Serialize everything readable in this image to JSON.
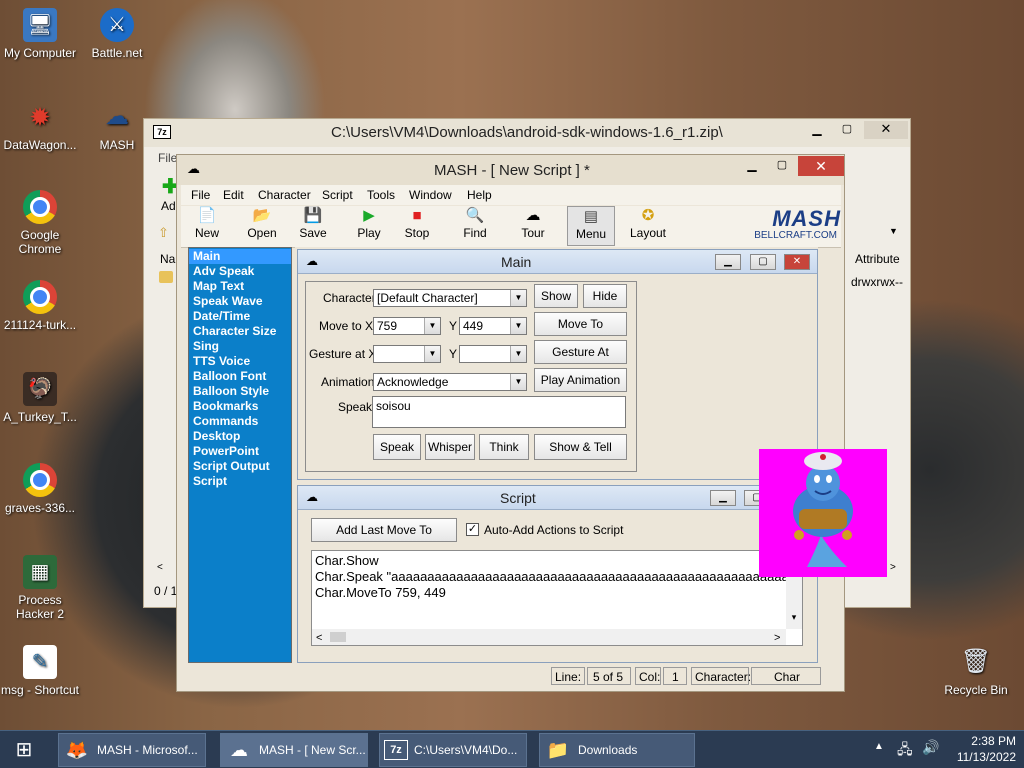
{
  "desktop": {
    "icons": [
      {
        "label": "My Computer",
        "glyph": "🖥"
      },
      {
        "label": "Battle.net",
        "glyph": "⚔"
      },
      {
        "label": "DataWagon...",
        "glyph": "✹"
      },
      {
        "label": "MASH",
        "glyph": "☁"
      },
      {
        "label": "Google Chrome",
        "glyph": ""
      },
      {
        "label": "211124-turk...",
        "glyph": ""
      },
      {
        "label": "A_Turkey_T...",
        "glyph": "🦃"
      },
      {
        "label": "graves-336...",
        "glyph": ""
      },
      {
        "label": "Process Hacker 2",
        "glyph": "▦"
      },
      {
        "label": "msg - Shortcut",
        "glyph": "✎"
      },
      {
        "label": "Recycle Bin",
        "glyph": "🗑"
      }
    ]
  },
  "zip_window": {
    "title": "C:\\Users\\VM4\\Downloads\\android-sdk-windows-1.6_r1.zip\\",
    "menu_first": "File",
    "add_label": "Ad",
    "col_name": "Nar",
    "col_attributes": "Attribute",
    "attr_value": "drwxrwx--",
    "status": "0 / 1"
  },
  "mash": {
    "title": "MASH - [ New Script ] *",
    "menu": [
      "File",
      "Edit",
      "Character",
      "Script",
      "Tools",
      "Window",
      "Help"
    ],
    "toolbar": [
      {
        "label": "New",
        "icon": "new-icon",
        "glyph": "📄"
      },
      {
        "label": "Open",
        "icon": "open-folder-icon",
        "glyph": "📂"
      },
      {
        "label": "Save",
        "icon": "save-icon",
        "glyph": "💾"
      },
      {
        "label": "Play",
        "icon": "play-icon",
        "glyph": "▶"
      },
      {
        "label": "Stop",
        "icon": "stop-icon",
        "glyph": "■"
      },
      {
        "label": "Find",
        "icon": "find-icon",
        "glyph": "🔍"
      },
      {
        "label": "Tour",
        "icon": "tour-icon",
        "glyph": "☁"
      },
      {
        "label": "Menu",
        "icon": "menu-icon",
        "glyph": "▤"
      },
      {
        "label": "Layout",
        "icon": "layout-icon",
        "glyph": "✪"
      }
    ],
    "logo_text": "MASH",
    "logo_sub": "BELLCRAFT.COM",
    "sidebar": [
      "Main",
      "Adv Speak",
      "Map Text",
      "Speak Wave",
      "Date/Time",
      "Character Size",
      "Sing",
      "TTS Voice",
      "Balloon Font",
      "Balloon Style",
      "Bookmarks",
      "Commands",
      "Desktop",
      "PowerPoint",
      "Script Output",
      "Script"
    ],
    "main_panel": {
      "title": "Main",
      "character_label": "Character",
      "character_value": "[Default Character]",
      "show_btn": "Show",
      "hide_btn": "Hide",
      "move_to_label": "Move to X",
      "move_x": "759",
      "move_y_label": "Y",
      "move_y": "449",
      "move_to_btn": "Move To",
      "gesture_label": "Gesture at X",
      "gesture_x": "",
      "gesture_y_label": "Y",
      "gesture_y": "",
      "gesture_btn": "Gesture At",
      "animation_label": "Animation",
      "animation_value": "Acknowledge",
      "play_anim_btn": "Play Animation",
      "speak_label": "Speak",
      "speak_text": "soisou",
      "speak_btn": "Speak",
      "whisper_btn": "Whisper",
      "think_btn": "Think",
      "show_tell_btn": "Show & Tell"
    },
    "script_panel": {
      "title": "Script",
      "add_last_btn": "Add Last Move To",
      "auto_add_label": "Auto-Add Actions to Script",
      "auto_add_checked": true,
      "lines": [
        "Char.Show",
        "Char.Speak \"aaaaaaaaaaaaaaaaaaaaaaaaaaaaaaaaaaaaaaaaaaaaaaaaaaaaaaaaaaaaaaaaa",
        "Char.MoveTo 759, 449"
      ]
    },
    "status": {
      "line_label": "Line:",
      "line_value": "5 of 5",
      "col_label": "Col:",
      "col_value": "1",
      "character_label": "Character:",
      "character_value": "Char"
    }
  },
  "taskbar": {
    "tasks": [
      {
        "label": "MASH - Microsof...",
        "icon": "firefox-icon",
        "glyph": "🦊"
      },
      {
        "label": "MASH - [ New Scr...",
        "icon": "mash-icon",
        "glyph": "☁"
      },
      {
        "label": "C:\\Users\\VM4\\Do...",
        "icon": "7zip-icon",
        "glyph": "7z"
      },
      {
        "label": "Downloads",
        "icon": "folder-icon",
        "glyph": "📁"
      }
    ],
    "time": "2:38 PM",
    "date": "11/13/2022"
  },
  "colors": {
    "sidebar_bg": "#0b7fc9",
    "sidebar_active": "#3399ff",
    "genie_bg": "#ff00ff",
    "mash_close": "#c7443a"
  }
}
